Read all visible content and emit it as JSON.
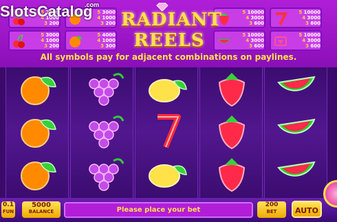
{
  "watermark": {
    "text": "SlotsCatalog",
    "suffix": ".com"
  },
  "game": {
    "title_line1": "RADIANT",
    "title_line2": "REELS"
  },
  "paytable": [
    {
      "symbol": "cherries-icon",
      "values": [
        {
          "k": "5",
          "v": "2000"
        },
        {
          "k": "4",
          "v": "1000"
        },
        {
          "k": "3",
          "v": "200"
        }
      ]
    },
    {
      "symbol": "orange-icon",
      "values": [
        {
          "k": "5",
          "v": "3000"
        },
        {
          "k": "4",
          "v": "1000"
        },
        {
          "k": "3",
          "v": "200"
        }
      ]
    },
    {
      "symbol": "cherries-icon",
      "values": [
        {
          "k": "5",
          "v": "3000"
        },
        {
          "k": "4",
          "v": "1000"
        },
        {
          "k": "3",
          "v": "200"
        }
      ]
    },
    {
      "symbol": "orange-icon",
      "values": [
        {
          "k": "5",
          "v": "4000"
        },
        {
          "k": "4",
          "v": "1000"
        },
        {
          "k": "3",
          "v": "300"
        }
      ]
    },
    {
      "symbol": "strawberry-icon",
      "values": [
        {
          "k": "5",
          "v": "10000"
        },
        {
          "k": "4",
          "v": "3000"
        },
        {
          "k": "3",
          "v": "600"
        }
      ]
    },
    {
      "symbol": "seven-icon",
      "values": [
        {
          "k": "5",
          "v": "10000"
        },
        {
          "k": "4",
          "v": "3000"
        },
        {
          "k": "3",
          "v": "600"
        }
      ]
    },
    {
      "symbol": "watermelon-icon",
      "values": [
        {
          "k": "5",
          "v": "10000"
        },
        {
          "k": "4",
          "v": "3000"
        },
        {
          "k": "3",
          "v": "600"
        }
      ]
    },
    {
      "symbol": "scatter-icon",
      "values": [
        {
          "k": "5",
          "v": "10000"
        },
        {
          "k": "4",
          "v": "3000"
        },
        {
          "k": "3",
          "v": "600"
        }
      ]
    }
  ],
  "banner": "All symbols pay for adjacent combinations on paylines.",
  "reels": [
    [
      "orange-icon",
      "orange-icon",
      "orange-icon"
    ],
    [
      "grapes-icon",
      "grapes-icon",
      "grapes-icon"
    ],
    [
      "lemon-icon",
      "seven-icon",
      "lemon-icon"
    ],
    [
      "strawberry-icon",
      "strawberry-icon",
      "strawberry-icon"
    ],
    [
      "watermelon-icon",
      "watermelon-icon",
      "watermelon-icon"
    ]
  ],
  "controls": {
    "coin": {
      "value": "0.1",
      "label": "FUN"
    },
    "balance": {
      "value": "5000",
      "label": "BALANCE"
    },
    "message": "Please place your bet",
    "bet": {
      "value": "200",
      "label": "BET"
    },
    "auto": "AUTO"
  },
  "colors": {
    "accent": "#ffe14a",
    "panel": "#b21ed8",
    "background": "#4a0f82"
  }
}
